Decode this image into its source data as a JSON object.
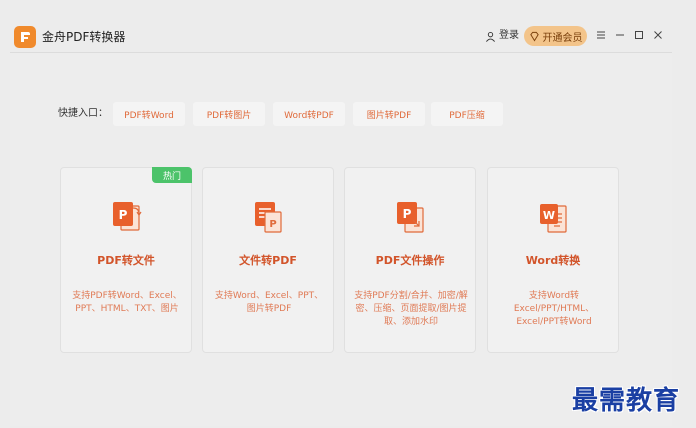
{
  "app": {
    "title": "金舟PDF转换器"
  },
  "header": {
    "login_label": "登录",
    "vip_label": "开通会员"
  },
  "quick_entry": {
    "label": "快捷入口：",
    "items": [
      {
        "label": "PDF转Word"
      },
      {
        "label": "PDF转图片"
      },
      {
        "label": "Word转PDF"
      },
      {
        "label": "图片转PDF"
      },
      {
        "label": "PDF压缩"
      }
    ]
  },
  "cards": [
    {
      "title": "PDF转文件",
      "desc": "支持PDF转Word、Excel、PPT、HTML、TXT、图片",
      "badge": "热门",
      "icon": "pdf-to-file-icon"
    },
    {
      "title": "文件转PDF",
      "desc": "支持Word、Excel、PPT、图片转PDF",
      "icon": "file-to-pdf-icon"
    },
    {
      "title": "PDF文件操作",
      "desc": "支持PDF分割/合并、加密/解密、压缩、页面提取/图片提取、添加水印",
      "icon": "pdf-operations-icon"
    },
    {
      "title": "Word转换",
      "desc": "支持Word转Excel/PPT/HTML、Excel/PPT转Word",
      "icon": "word-convert-icon"
    }
  ],
  "watermark": "最需教育",
  "colors": {
    "accent": "#d2542a",
    "vip_bg": "#f3c48a",
    "hot_badge": "#4cc36a",
    "watermark": "#1a3fa3"
  }
}
